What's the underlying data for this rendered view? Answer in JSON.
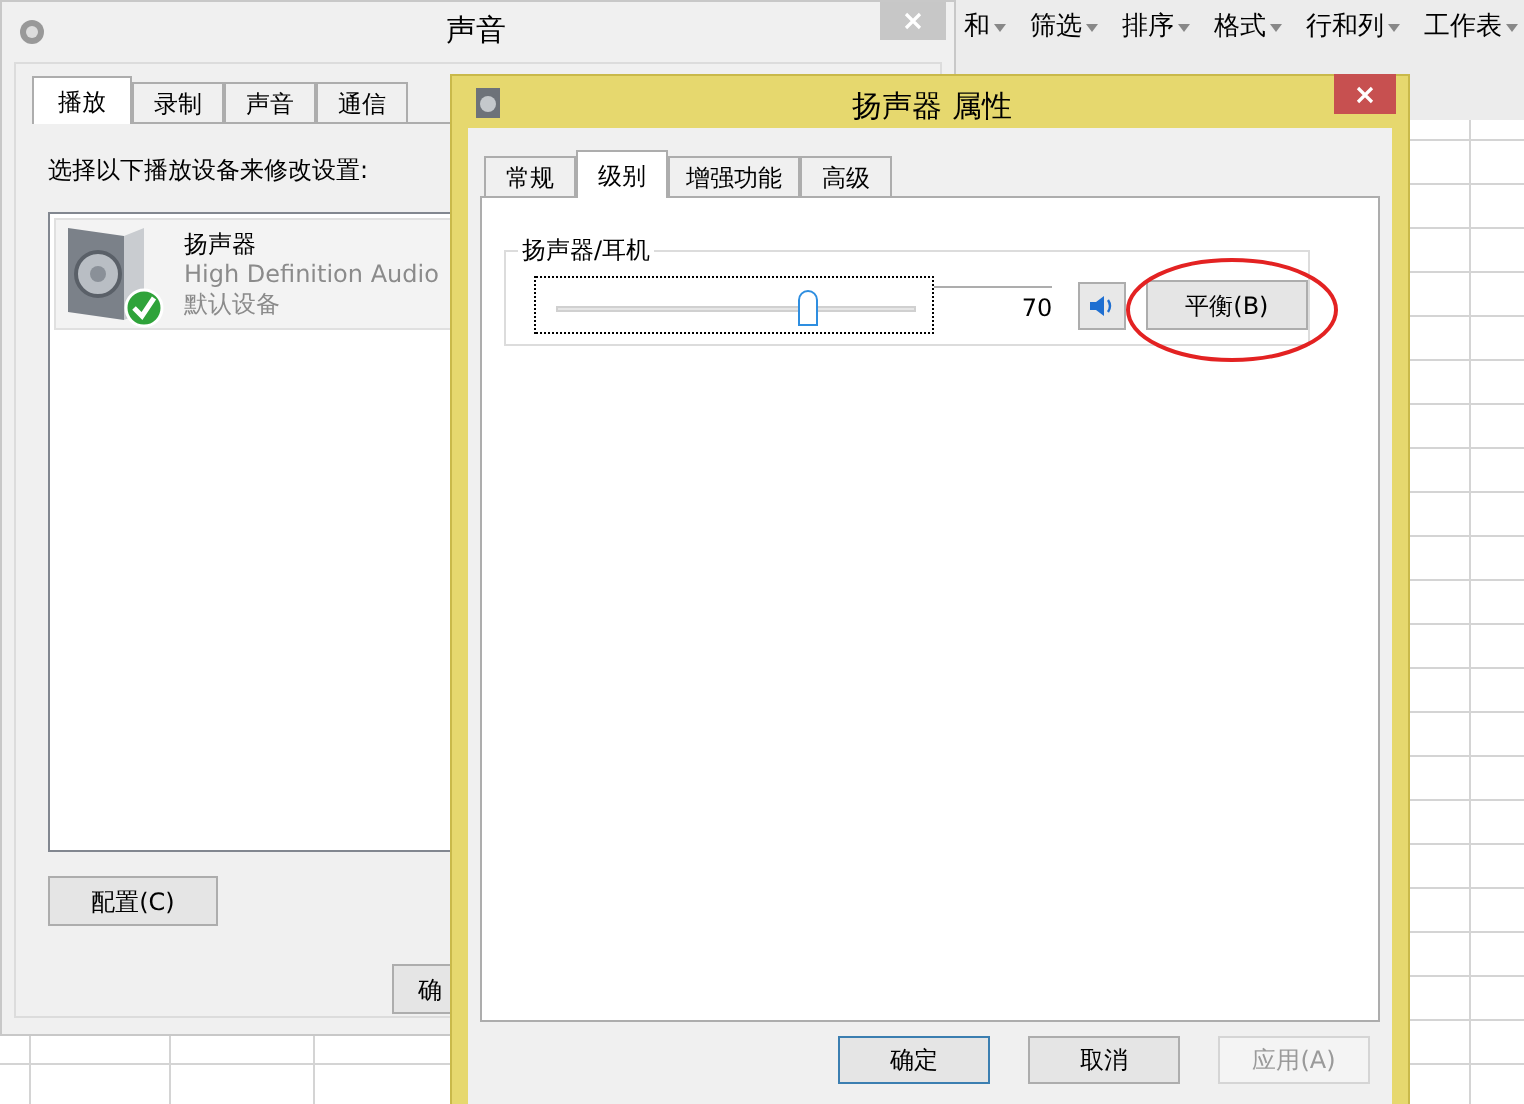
{
  "spreadsheet": {
    "menu": [
      {
        "label": "和"
      },
      {
        "label": "筛选"
      },
      {
        "label": "排序"
      },
      {
        "label": "格式"
      },
      {
        "label": "行和列"
      },
      {
        "label": "工作表"
      }
    ]
  },
  "sound_window": {
    "title": "声音",
    "tabs": [
      {
        "label": "播放",
        "selected": true
      },
      {
        "label": "录制",
        "selected": false
      },
      {
        "label": "声音",
        "selected": false
      },
      {
        "label": "通信",
        "selected": false
      }
    ],
    "instruction": "选择以下播放设备来修改设置:",
    "devices": [
      {
        "name": "扬声器",
        "driver": "High Definition Audio",
        "status": "默认设备",
        "default": true
      }
    ],
    "configure_button": "配置(C)",
    "ok_button": "确"
  },
  "properties_dialog": {
    "title": "扬声器 属性",
    "tabs": [
      {
        "label": "常规",
        "selected": false
      },
      {
        "label": "级别",
        "selected": true
      },
      {
        "label": "增强功能",
        "selected": false
      },
      {
        "label": "高级",
        "selected": false
      }
    ],
    "group_label": "扬声器/耳机",
    "volume": {
      "level": 0.7,
      "reading": "70",
      "muted": false
    },
    "balance_button": "平衡(B)",
    "buttons": [
      {
        "label": "确定",
        "disabled": false,
        "default": true
      },
      {
        "label": "取消",
        "disabled": false,
        "default": false
      },
      {
        "label": "应用(A)",
        "disabled": true,
        "default": false
      }
    ]
  }
}
